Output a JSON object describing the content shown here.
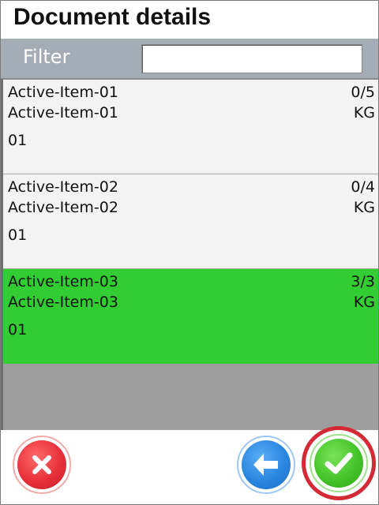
{
  "header": {
    "title": "Document details"
  },
  "filter": {
    "label": "Filter",
    "value": ""
  },
  "items": [
    {
      "name": "Active-Item-01",
      "description": "Active-Item-01",
      "quantity": "0/5",
      "unit": "KG",
      "location": "01",
      "status": "pending"
    },
    {
      "name": "Active-Item-02",
      "description": "Active-Item-02",
      "quantity": "0/4",
      "unit": "KG",
      "location": "01",
      "status": "pending"
    },
    {
      "name": "Active-Item-03",
      "description": "Active-Item-03",
      "quantity": "3/3",
      "unit": "KG",
      "location": "01",
      "status": "complete"
    }
  ],
  "actions": {
    "cancel": {
      "icon": "close-icon"
    },
    "back": {
      "icon": "arrow-left-icon"
    },
    "confirm": {
      "icon": "checkmark-icon"
    }
  },
  "colors": {
    "filter_bar": "#a4acb6",
    "complete_row": "#32cd32",
    "cancel": "#e8303a",
    "back": "#2a86e0",
    "confirm": "#45c429",
    "confirm_highlight": "#d42a36"
  }
}
